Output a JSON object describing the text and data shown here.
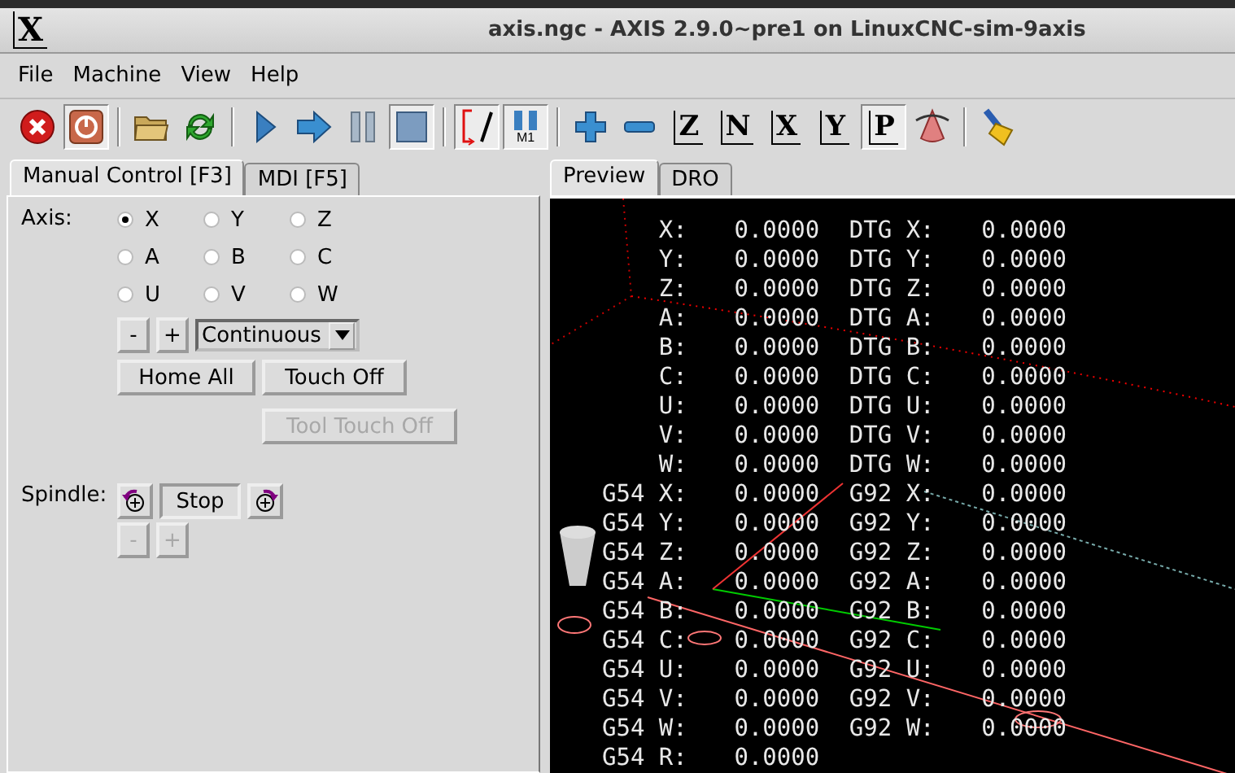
{
  "window": {
    "logo": "X",
    "title": "axis.ngc - AXIS 2.9.0~pre1 on LinuxCNC-sim-9axis"
  },
  "menu": [
    "File",
    "Machine",
    "View",
    "Help"
  ],
  "toolbar": [
    {
      "kind": "estop",
      "pressed": false
    },
    {
      "kind": "power",
      "pressed": true
    },
    {
      "kind": "separator"
    },
    {
      "kind": "open",
      "pressed": false
    },
    {
      "kind": "reload",
      "pressed": false
    },
    {
      "kind": "separator"
    },
    {
      "kind": "run",
      "pressed": false
    },
    {
      "kind": "step",
      "pressed": false
    },
    {
      "kind": "pause",
      "pressed": false
    },
    {
      "kind": "stop",
      "pressed": true
    },
    {
      "kind": "separator"
    },
    {
      "kind": "blockdelete",
      "pressed": true
    },
    {
      "kind": "optstop",
      "label": "M1",
      "pressed": true
    },
    {
      "kind": "separator"
    },
    {
      "kind": "zoomin",
      "pressed": false
    },
    {
      "kind": "zoomout",
      "pressed": false
    },
    {
      "kind": "view",
      "label": "Z",
      "pressed": false
    },
    {
      "kind": "view",
      "label": "N",
      "pressed": false
    },
    {
      "kind": "view",
      "label": "X",
      "pressed": false
    },
    {
      "kind": "view",
      "label": "Y",
      "pressed": false
    },
    {
      "kind": "view",
      "label": "P",
      "pressed": true
    },
    {
      "kind": "rotate",
      "pressed": false
    },
    {
      "kind": "separator"
    },
    {
      "kind": "clear",
      "pressed": false
    }
  ],
  "left_tabs": [
    {
      "label": "Manual Control [F3]",
      "selected": true
    },
    {
      "label": "MDI [F5]",
      "selected": false
    }
  ],
  "manual": {
    "axis_label": "Axis:",
    "axes": [
      {
        "label": "X",
        "selected": true
      },
      {
        "label": "Y",
        "selected": false
      },
      {
        "label": "Z",
        "selected": false
      },
      {
        "label": "A",
        "selected": false
      },
      {
        "label": "B",
        "selected": false
      },
      {
        "label": "C",
        "selected": false
      },
      {
        "label": "U",
        "selected": false
      },
      {
        "label": "V",
        "selected": false
      },
      {
        "label": "W",
        "selected": false
      }
    ],
    "jog_minus": "-",
    "jog_plus": "+",
    "increment": "Continuous",
    "buttons": [
      {
        "label": "Home All",
        "disabled": false
      },
      {
        "label": "Touch Off",
        "disabled": false
      },
      {
        "label": "Tool Touch Off",
        "disabled": true
      }
    ],
    "spindle_label": "Spindle:",
    "spindle_stop": "Stop",
    "speed_buttons": [
      {
        "label": "-",
        "disabled": true
      },
      {
        "label": "+",
        "disabled": true
      }
    ]
  },
  "right_tabs": [
    {
      "label": "Preview",
      "selected": true
    },
    {
      "label": "DRO",
      "selected": false
    }
  ],
  "dro": [
    [
      "X:",
      "0.0000",
      "DTG X:",
      "0.0000"
    ],
    [
      "Y:",
      "0.0000",
      "DTG Y:",
      "0.0000"
    ],
    [
      "Z:",
      "0.0000",
      "DTG Z:",
      "0.0000"
    ],
    [
      "A:",
      "0.0000",
      "DTG A:",
      "0.0000"
    ],
    [
      "B:",
      "0.0000",
      "DTG B:",
      "0.0000"
    ],
    [
      "C:",
      "0.0000",
      "DTG C:",
      "0.0000"
    ],
    [
      "U:",
      "0.0000",
      "DTG U:",
      "0.0000"
    ],
    [
      "V:",
      "0.0000",
      "DTG V:",
      "0.0000"
    ],
    [
      "W:",
      "0.0000",
      "DTG W:",
      "0.0000"
    ],
    [
      "G54 X:",
      "0.0000",
      "G92 X:",
      "0.0000"
    ],
    [
      "G54 Y:",
      "0.0000",
      "G92 Y:",
      "0.0000"
    ],
    [
      "G54 Z:",
      "0.0000",
      "G92 Z:",
      "0.0000"
    ],
    [
      "G54 A:",
      "0.0000",
      "G92 A:",
      "0.0000"
    ],
    [
      "G54 B:",
      "0.0000",
      "G92 B:",
      "0.0000"
    ],
    [
      "G54 C:",
      "0.0000",
      "G92 C:",
      "0.0000"
    ],
    [
      "G54 U:",
      "0.0000",
      "G92 U:",
      "0.0000"
    ],
    [
      "G54 V:",
      "0.0000",
      "G92 V:",
      "0.0000"
    ],
    [
      "G54 W:",
      "0.0000",
      "G92 W:",
      "0.0000"
    ],
    [
      "G54 R:",
      "0.0000"
    ]
  ]
}
